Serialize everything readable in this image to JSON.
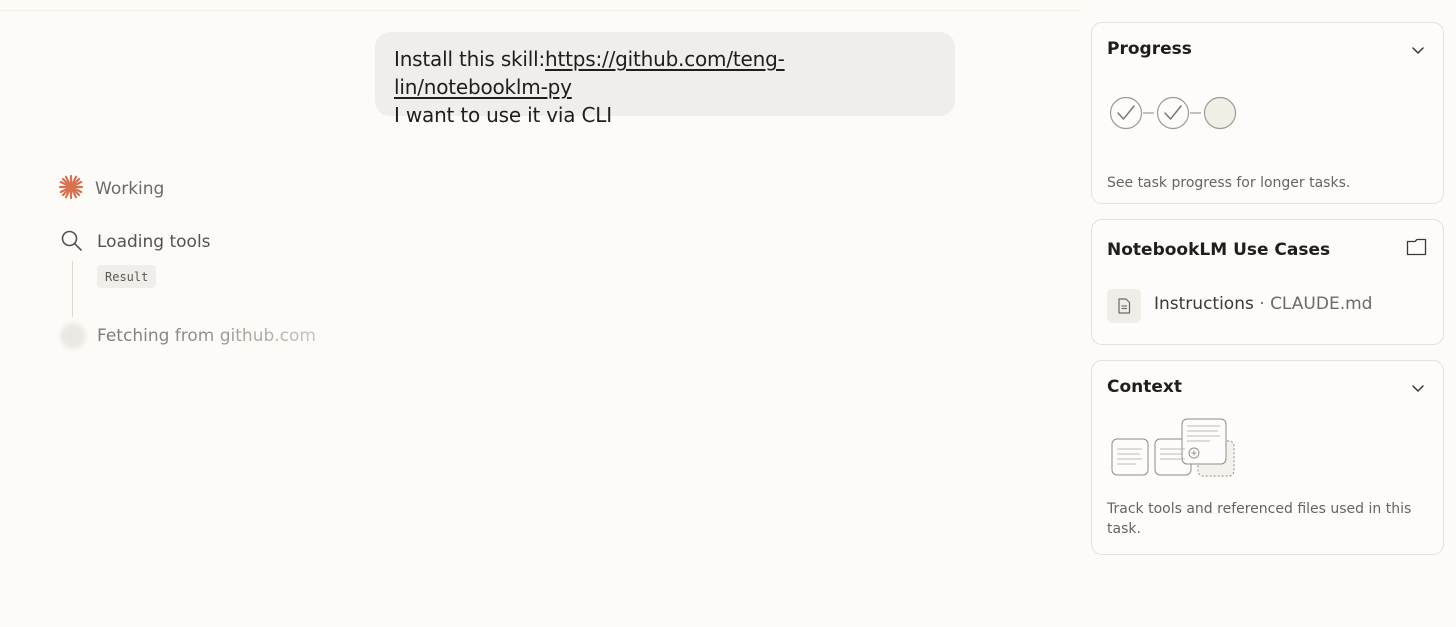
{
  "message": {
    "prefix": "Install this skill:",
    "link": "https://github.com/teng-lin/notebooklm-py",
    "line2": "I want to use it via CLI"
  },
  "activity": {
    "working_label": "Working",
    "loading_label": "Loading tools",
    "result_label": "Result",
    "fetching_label": "Fetching from github.com"
  },
  "panels": {
    "progress": {
      "title": "Progress",
      "description": "See task progress for longer tasks.",
      "steps": [
        "done",
        "done",
        "pending"
      ]
    },
    "usecases": {
      "title": "NotebookLM Use Cases",
      "file_name": "Instructions",
      "file_separator": " · ",
      "file_path": "CLAUDE.md"
    },
    "context": {
      "title": "Context",
      "description": "Track tools and referenced files used in this task."
    }
  },
  "colors": {
    "accent": "#d9704f",
    "background": "#fcfbf8",
    "bubble": "#f0eeea"
  },
  "icons": {
    "working": "sparkle-icon",
    "loading": "search-icon",
    "collapse": "chevron-down-icon",
    "folder": "folder-icon",
    "document": "document-icon"
  }
}
